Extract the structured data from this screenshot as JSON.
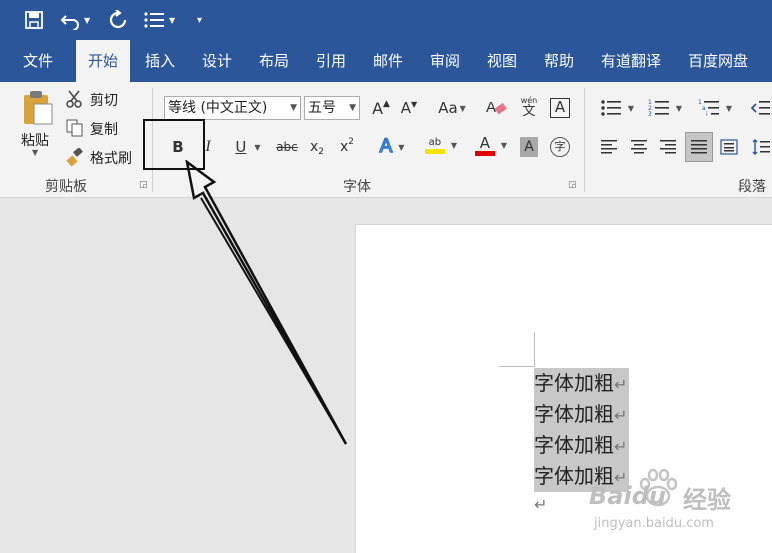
{
  "quick_access": {
    "icons": [
      "save-icon",
      "undo-icon",
      "redo-icon",
      "list-icon",
      "customize-icon"
    ]
  },
  "tabs": [
    "文件",
    "开始",
    "插入",
    "设计",
    "布局",
    "引用",
    "邮件",
    "审阅",
    "视图",
    "帮助",
    "有道翻译",
    "百度网盘"
  ],
  "active_tab": "开始",
  "clipboard": {
    "paste_label": "粘贴",
    "cut_label": "剪切",
    "copy_label": "复制",
    "format_painter_label": "格式刷",
    "group_label": "剪贴板"
  },
  "font": {
    "font_name": "等线 (中文正文)",
    "font_size": "五号",
    "grow_label": "A",
    "shrink_label": "A",
    "case_label": "Aa",
    "pinyin_label": "wén",
    "border_label": "A",
    "bold_label": "B",
    "italic_label": "I",
    "underline_label": "U",
    "strike_label": "abc",
    "sub_label": "x",
    "sub_mark": "2",
    "sup_label": "x",
    "sup_mark": "2",
    "effects_label": "A",
    "highlight_label": "ab",
    "color_label": "A",
    "shading_label": "A",
    "enclose_label": "字",
    "group_label": "字体"
  },
  "paragraph": {
    "group_label": "段落"
  },
  "colors": {
    "ribbon_blue": "#2b579a",
    "highlight_yellow": "#f5e400",
    "font_red": "#e00000",
    "selection_gray": "#c8c8c8"
  },
  "document": {
    "lines": [
      "字体加粗",
      "字体加粗",
      "字体加粗",
      "字体加粗"
    ],
    "paragraph_mark": "↵"
  },
  "watermark": {
    "brand": "Baidu",
    "brand_cn": "经验",
    "url": "jingyan.baidu.com"
  }
}
